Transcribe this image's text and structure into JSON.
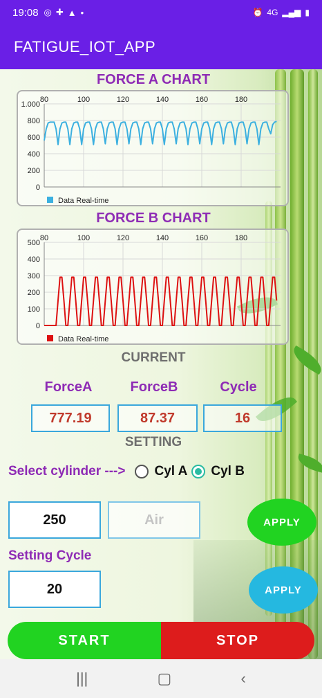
{
  "status_bar": {
    "time": "19:08",
    "network": "4G",
    "left_icons": [
      "whatsapp-icon",
      "puzzle-icon",
      "warning-icon",
      "dot-icon"
    ],
    "right_icons": [
      "alarm-icon",
      "network-icon",
      "signal-icon",
      "battery-icon"
    ]
  },
  "app_bar": {
    "title": "FATIGUE_IOT_APP"
  },
  "charts": {
    "force_a": {
      "title": "FORCE A CHART",
      "legend": "Data Real-time",
      "color": "#3cb0e0"
    },
    "force_b": {
      "title": "FORCE B CHART",
      "legend": "Data Real-time",
      "color": "#dd1111"
    }
  },
  "chart_data": [
    {
      "type": "line",
      "title": "FORCE A CHART",
      "x_ticks": [
        80,
        100,
        120,
        140,
        160,
        180
      ],
      "y_ticks": [
        "0",
        "200",
        "400",
        "600",
        "800",
        "1.000"
      ],
      "xlim": [
        80,
        200
      ],
      "ylim": [
        0,
        1000
      ],
      "grid": true,
      "legend_position": "bottom-left",
      "series": [
        {
          "name": "Data Real-time",
          "color": "#3cb0e0",
          "x": [
            80,
            81,
            82,
            83,
            84,
            85,
            86,
            87,
            88,
            89,
            90,
            91,
            92,
            93,
            94,
            95,
            96,
            97,
            98,
            99,
            100,
            101,
            102,
            103,
            104,
            105,
            106,
            107,
            108,
            109,
            110,
            111,
            112,
            113,
            114,
            115,
            116,
            117,
            118,
            119,
            120,
            121,
            122,
            123,
            124,
            125,
            126,
            127,
            128,
            129,
            130,
            131,
            132,
            133,
            134,
            135,
            136,
            137,
            138,
            139,
            140,
            141,
            142,
            143,
            144,
            145,
            146,
            147,
            148,
            149,
            150,
            151,
            152,
            153,
            154,
            155,
            156,
            157,
            158,
            159,
            160,
            161,
            162,
            163,
            164,
            165,
            166,
            167,
            168,
            169,
            170,
            171,
            172,
            173,
            174,
            175,
            176,
            177,
            178,
            179,
            180,
            181,
            182,
            183,
            184,
            185,
            186,
            187,
            188,
            189,
            190,
            191,
            192,
            193,
            194,
            195,
            196,
            197,
            198
          ],
          "y": [
            560,
            700,
            770,
            780,
            780,
            780,
            700,
            510,
            700,
            770,
            780,
            780,
            700,
            510,
            700,
            770,
            780,
            780,
            700,
            510,
            700,
            770,
            780,
            780,
            700,
            510,
            700,
            770,
            780,
            780,
            700,
            520,
            700,
            770,
            780,
            780,
            700,
            510,
            700,
            770,
            780,
            780,
            700,
            520,
            700,
            770,
            780,
            780,
            700,
            510,
            700,
            770,
            780,
            780,
            700,
            520,
            700,
            770,
            780,
            780,
            700,
            510,
            700,
            770,
            780,
            780,
            700,
            520,
            700,
            770,
            780,
            780,
            700,
            510,
            700,
            770,
            780,
            780,
            700,
            520,
            700,
            770,
            780,
            780,
            700,
            510,
            700,
            770,
            780,
            780,
            700,
            520,
            700,
            770,
            780,
            780,
            700,
            510,
            700,
            770,
            780,
            780,
            700,
            520,
            700,
            770,
            780,
            780,
            700,
            510,
            700,
            770,
            780,
            780,
            700,
            640,
            750,
            780,
            790
          ]
        }
      ]
    },
    {
      "type": "line",
      "title": "FORCE B CHART",
      "x_ticks": [
        80,
        100,
        120,
        140,
        160,
        180
      ],
      "y_ticks": [
        "0",
        "100",
        "200",
        "300",
        "400",
        "500"
      ],
      "xlim": [
        80,
        200
      ],
      "ylim": [
        0,
        500
      ],
      "grid": true,
      "legend_position": "bottom-left",
      "series": [
        {
          "name": "Data Real-time",
          "color": "#dd1111",
          "x": [
            80,
            81,
            82,
            83,
            84,
            85,
            86,
            87,
            88,
            89,
            90,
            91,
            92,
            93,
            94,
            95,
            96,
            97,
            98,
            99,
            100,
            101,
            102,
            103,
            104,
            105,
            106,
            107,
            108,
            109,
            110,
            111,
            112,
            113,
            114,
            115,
            116,
            117,
            118,
            119,
            120,
            121,
            122,
            123,
            124,
            125,
            126,
            127,
            128,
            129,
            130,
            131,
            132,
            133,
            134,
            135,
            136,
            137,
            138,
            139,
            140,
            141,
            142,
            143,
            144,
            145,
            146,
            147,
            148,
            149,
            150,
            151,
            152,
            153,
            154,
            155,
            156,
            157,
            158,
            159,
            160,
            161,
            162,
            163,
            164,
            165,
            166,
            167,
            168,
            169,
            170,
            171,
            172,
            173,
            174,
            175,
            176,
            177,
            178,
            179,
            180,
            181,
            182,
            183,
            184,
            185,
            186,
            187,
            188,
            189,
            190,
            191,
            192,
            193,
            194,
            195,
            196,
            197,
            198
          ],
          "y": [
            0,
            0,
            0,
            0,
            0,
            0,
            0,
            150,
            290,
            290,
            150,
            0,
            0,
            150,
            290,
            290,
            150,
            0,
            0,
            150,
            290,
            290,
            150,
            0,
            0,
            150,
            290,
            290,
            150,
            0,
            0,
            150,
            290,
            290,
            150,
            0,
            0,
            150,
            290,
            290,
            150,
            0,
            0,
            150,
            290,
            290,
            150,
            0,
            0,
            150,
            290,
            290,
            150,
            0,
            0,
            150,
            290,
            290,
            150,
            0,
            0,
            150,
            290,
            290,
            150,
            0,
            0,
            150,
            290,
            290,
            150,
            0,
            0,
            150,
            290,
            290,
            150,
            0,
            0,
            150,
            290,
            290,
            150,
            0,
            0,
            150,
            290,
            290,
            150,
            0,
            0,
            150,
            290,
            290,
            150,
            0,
            0,
            150,
            290,
            290,
            150,
            0,
            0,
            150,
            290,
            290,
            150,
            0,
            0,
            150,
            290,
            290,
            150,
            0,
            0,
            150,
            290,
            290,
            150
          ]
        }
      ]
    }
  ],
  "current": {
    "heading": "CURRENT",
    "labels": [
      "ForceA",
      "ForceB",
      "Cycle"
    ],
    "values": [
      "777.19",
      "87.37",
      "16"
    ]
  },
  "setting": {
    "heading": "SETTING",
    "select_label": "Select cylinder --->",
    "options": [
      {
        "label": "Cyl A",
        "selected": false
      },
      {
        "label": "Cyl B",
        "selected": true
      }
    ],
    "force_value": "250",
    "air_placeholder": "Air",
    "apply_label": "APPLY",
    "cycle_label": "Setting Cycle",
    "cycle_value": "20",
    "apply2_label": "APPLY"
  },
  "actions": {
    "start_label": "START",
    "stop_label": "STOP"
  },
  "colors": {
    "primary": "#6a1fe6",
    "accent_purple": "#8e2bb5",
    "value_red": "#c0392b",
    "box_blue": "#3aa7dc",
    "apply_green": "#21d321",
    "apply_cyan": "#25b8e0",
    "start_green": "#21d321",
    "stop_red": "#dd1c1c"
  }
}
